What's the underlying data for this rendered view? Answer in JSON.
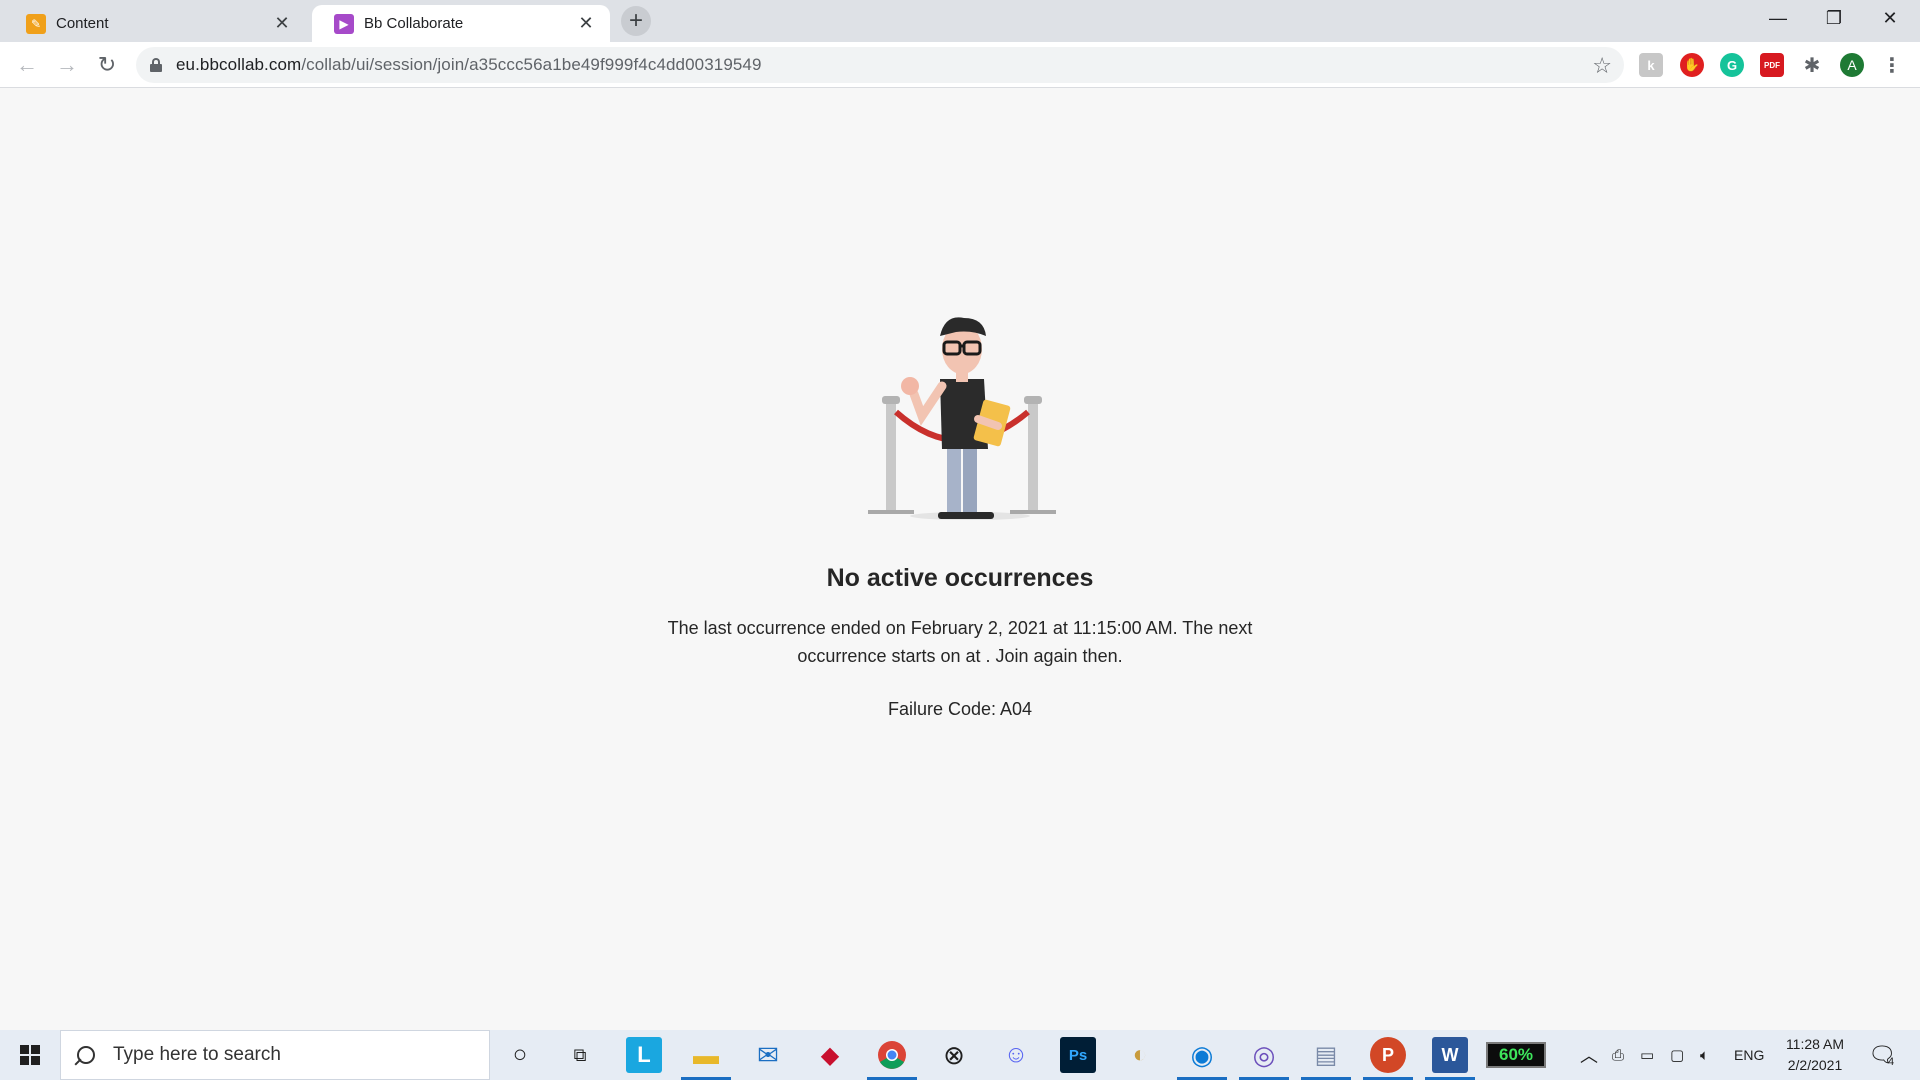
{
  "browser": {
    "tabs": [
      {
        "title": "Content",
        "favicon": "pencil-icon",
        "active": false
      },
      {
        "title": "Bb Collaborate",
        "favicon": "collaborate-icon",
        "active": true
      }
    ],
    "url_host": "eu.bbcollab.com",
    "url_path": "/collab/ui/session/join/a35ccc56a1be49f999f4c4dd00319549",
    "profile_initial": "A"
  },
  "page": {
    "heading": "No active occurrences",
    "message": "The last occurrence ended on February 2, 2021 at 11:15:00 AM. The next occurrence starts on at . Join again then.",
    "failure_code": "Failure Code: A04"
  },
  "taskbar": {
    "search_placeholder": "Type here to search",
    "battery_percent": "60%",
    "language": "ENG",
    "time": "11:28 AM",
    "date": "2/2/2021",
    "notification_count": "4",
    "app_letters": {
      "lightshot": "L",
      "photoshop": "Ps",
      "powerpoint": "P",
      "word": "W"
    }
  },
  "colors": {
    "accent_blue": "#1b6ec2",
    "tab_strip": "#dee1e6",
    "page_bg": "#f7f7f7"
  }
}
